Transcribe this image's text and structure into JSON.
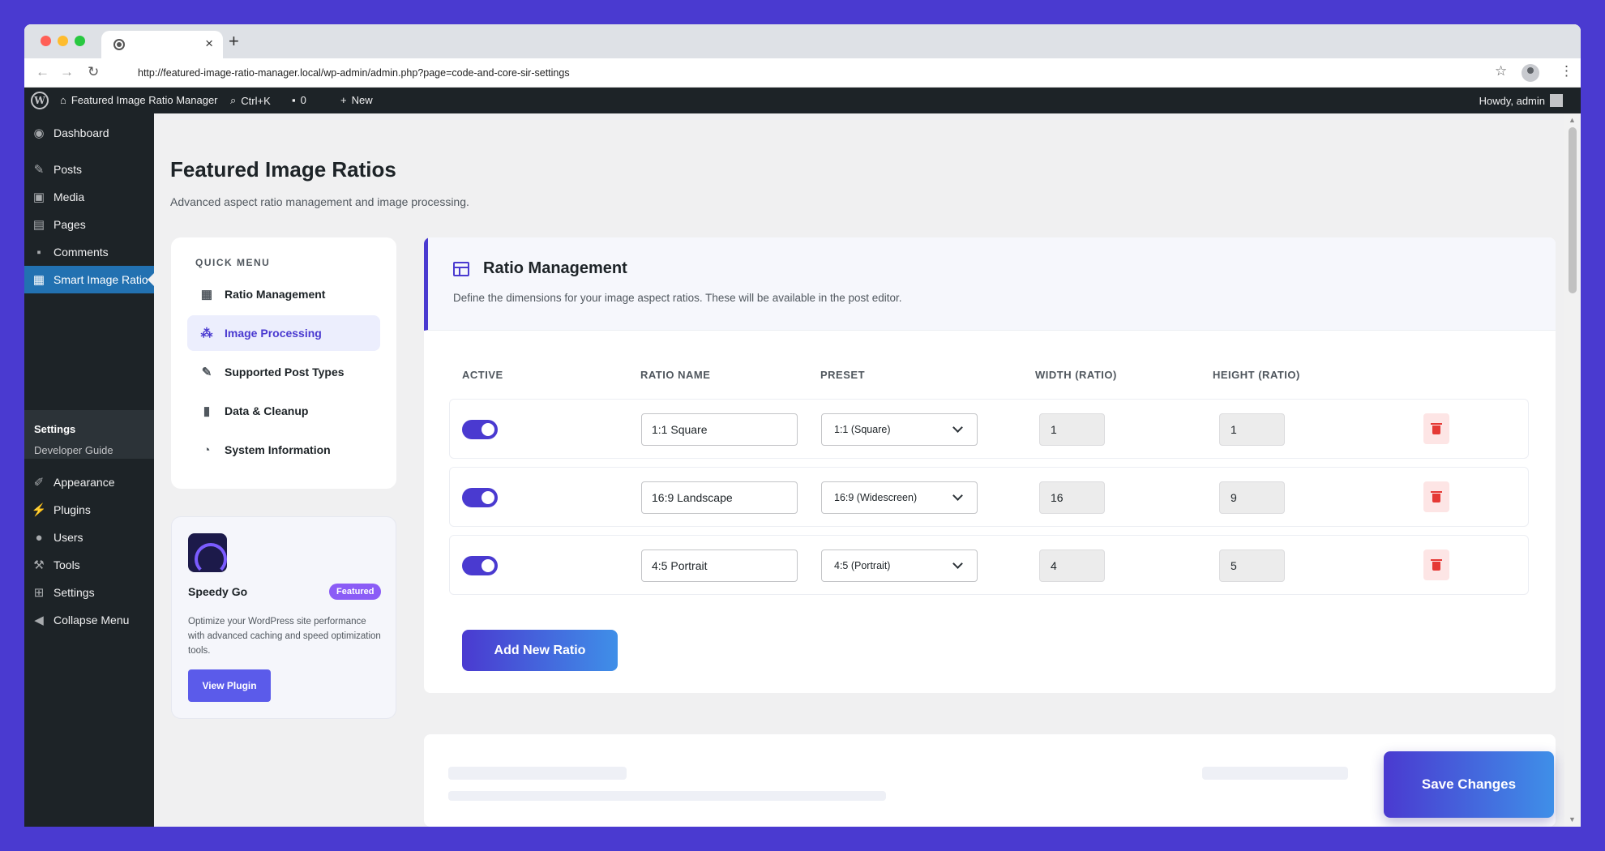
{
  "browser": {
    "url": "http://featured-image-ratio-manager.local/wp-admin/admin.php?page=code-and-core-sir-settings"
  },
  "adminbar": {
    "site_name": "Featured Image Ratio Manager",
    "search_shortcut": "Ctrl+K",
    "comments_count": "0",
    "new_label": "New",
    "howdy": "Howdy, admin"
  },
  "sidebar": {
    "items": [
      {
        "label": "Dashboard",
        "icon": "dashboard-icon"
      },
      {
        "label": "Posts",
        "icon": "pin-icon"
      },
      {
        "label": "Media",
        "icon": "media-icon"
      },
      {
        "label": "Pages",
        "icon": "pages-icon"
      },
      {
        "label": "Comments",
        "icon": "comment-icon"
      },
      {
        "label": "Smart Image Ratio",
        "icon": "image-ratio-icon"
      },
      {
        "label": "Appearance",
        "icon": "brush-icon"
      },
      {
        "label": "Plugins",
        "icon": "plug-icon"
      },
      {
        "label": "Users",
        "icon": "user-icon"
      },
      {
        "label": "Tools",
        "icon": "wrench-icon"
      },
      {
        "label": "Settings",
        "icon": "settings-icon"
      },
      {
        "label": "Collapse Menu",
        "icon": "collapse-icon"
      }
    ],
    "submenu": [
      "Settings",
      "Developer Guide"
    ]
  },
  "page": {
    "title": "Featured Image Ratios",
    "description": "Advanced aspect ratio management and image processing."
  },
  "quick_menu": {
    "title": "QUICK MENU",
    "items": [
      {
        "label": "Ratio Management",
        "icon": "table-icon"
      },
      {
        "label": "Image Processing",
        "icon": "circles-icon"
      },
      {
        "label": "Supported Post Types",
        "icon": "pin-icon"
      },
      {
        "label": "Data & Cleanup",
        "icon": "trash-icon"
      },
      {
        "label": "System Information",
        "icon": "gauge-icon"
      }
    ],
    "active_item": "Image Processing"
  },
  "promo": {
    "name": "Speedy Go",
    "badge": "Featured",
    "description": "Optimize your WordPress site performance with advanced caching and speed optimization tools.",
    "button": "View Plugin"
  },
  "ratio_management": {
    "title": "Ratio Management",
    "description": "Define the dimensions for your image aspect ratios. These will be available in the post editor.",
    "columns": [
      "ACTIVE",
      "RATIO NAME",
      "PRESET",
      "WIDTH (RATIO)",
      "HEIGHT (RATIO)"
    ],
    "rows": [
      {
        "active": true,
        "name": "1:1 Square",
        "preset": "1:1 (Square)",
        "width": "1",
        "height": "1"
      },
      {
        "active": true,
        "name": "16:9 Landscape",
        "preset": "16:9 (Widescreen)",
        "width": "16",
        "height": "9"
      },
      {
        "active": true,
        "name": "4:5 Portrait",
        "preset": "4:5 (Portrait)",
        "width": "4",
        "height": "5"
      }
    ],
    "add_button": "Add New Ratio"
  },
  "save_button": "Save Changes",
  "colors": {
    "accent": "#4a3ad0",
    "gradient_end": "#3f8fe8",
    "wp_admin": "#1d2327",
    "wp_blue": "#2271b1",
    "delete_red": "#e53935"
  }
}
